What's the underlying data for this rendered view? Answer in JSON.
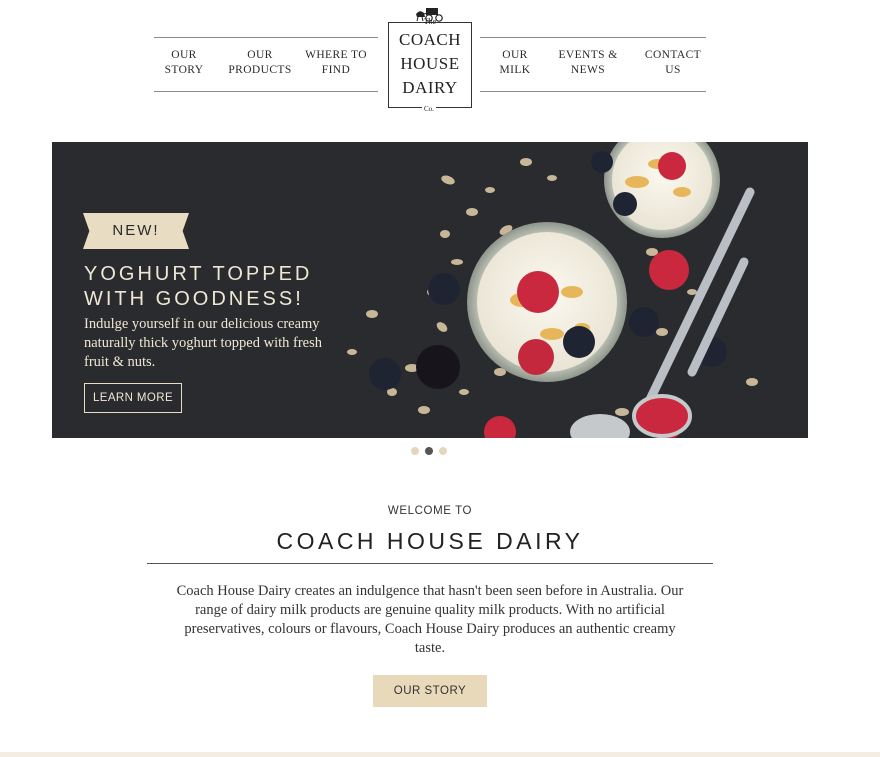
{
  "nav": {
    "left": [
      {
        "line1": "OUR",
        "line2": "STORY"
      },
      {
        "line1": "OUR",
        "line2": "PRODUCTS"
      },
      {
        "line1": "WHERE TO",
        "line2": "FIND"
      }
    ],
    "right": [
      {
        "line1": "OUR",
        "line2": "MILK"
      },
      {
        "line1": "EVENTS &",
        "line2": "NEWS"
      },
      {
        "line1": "CONTACT",
        "line2": "US"
      }
    ]
  },
  "logo": {
    "the": "The",
    "line1": "COACH",
    "line2": "HOUSE",
    "line3": "DAIRY",
    "co": "Co."
  },
  "hero": {
    "badge": "NEW!",
    "title_line1": "YOGHURT TOPPED",
    "title_line2": "WITH GOODNESS!",
    "text": "Indulge yourself in our delicious creamy naturally thick yoghurt topped with fresh fruit & nuts.",
    "button": "LEARN MORE"
  },
  "carousel": {
    "slides": 3,
    "active_slide": 2
  },
  "welcome": {
    "kicker": "WELCOME TO",
    "title": "COACH HOUSE DAIRY",
    "text": "Coach House Dairy creates an indulgence that hasn't been seen before in Australia. Our range of dairy milk products are genuine quality milk products. With no artificial preservatives, colours or flavours, Coach House Dairy produces an authentic creamy taste.",
    "button": "OUR STORY"
  },
  "colors": {
    "accent": "#e8d9ba",
    "hero_background": "#2a2b2e",
    "hero_text": "#efe7d4",
    "dot_active": "#555555"
  }
}
